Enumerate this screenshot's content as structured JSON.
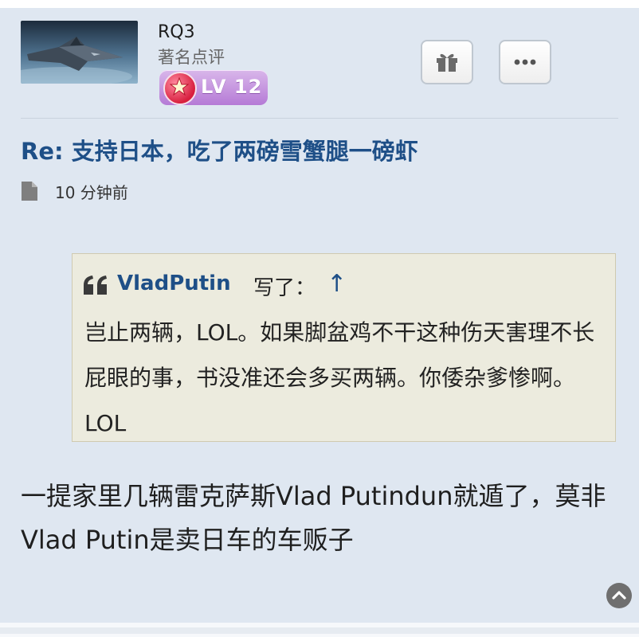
{
  "user": {
    "name": "RQ3",
    "title": "著名点评",
    "level": "LV 12",
    "avatar_icon": "fighter-jet-avatar"
  },
  "actions": {
    "gift_icon": "gift-icon",
    "more_icon": "more-icon"
  },
  "post": {
    "title": "Re: 支持日本，吃了两磅雪蟹腿一磅虾",
    "time": "10 分钟前",
    "body": "一提家里几辆雷克萨斯Vlad Putindun就遁了，莫非Vlad Putin是卖日车的车贩子"
  },
  "quote": {
    "author": "VladPutin",
    "wrote": "写了：",
    "arrow": "↑",
    "text": "岂止两辆，LOL。如果脚盆鸡不干这种伤天害理不长屁眼的事，书没准还会多买两辆。你倭杂爹惨啊。 LOL"
  },
  "colors": {
    "link": "#1e4f87",
    "card_bg": "#dfe7f1",
    "quote_bg": "#ecebde"
  }
}
